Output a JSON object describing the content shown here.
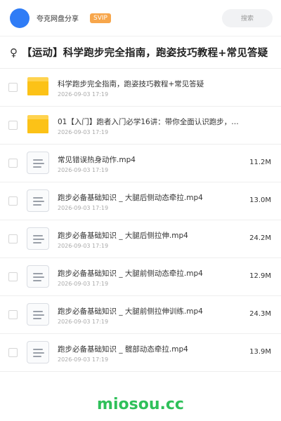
{
  "header": {
    "app_name": "夸克网盘分享",
    "badge": "SVIP",
    "search_placeholder": "搜索"
  },
  "share": {
    "gender_icon": "♀",
    "title": "【运动】科学跑步完全指南，跑姿技巧教程+常见答疑"
  },
  "files": [
    {
      "type": "folder",
      "name": "科学跑步完全指南，跑姿技巧教程+常见答疑",
      "date": "2026-09-03 17:19",
      "size": ""
    },
    {
      "type": "folder",
      "name": "01【入门】跑者入门必学16讲：带你全面认识跑步，…",
      "date": "2026-09-03 17:19",
      "size": ""
    },
    {
      "type": "file",
      "name": "常见错误热身动作.mp4",
      "date": "2026-09-03 17:19",
      "size": "11.2M"
    },
    {
      "type": "file",
      "name": "跑步必备基础知识 _ 大腿后侧动态牵拉.mp4",
      "date": "2026-09-03 17:19",
      "size": "13.0M"
    },
    {
      "type": "file",
      "name": "跑步必备基础知识 _ 大腿后侧拉伸.mp4",
      "date": "2026-09-03 17:19",
      "size": "24.2M"
    },
    {
      "type": "file",
      "name": "跑步必备基础知识 _ 大腿前侧动态牵拉.mp4",
      "date": "2026-09-03 17:19",
      "size": "12.9M"
    },
    {
      "type": "file",
      "name": "跑步必备基础知识 _ 大腿前侧拉伸训练.mp4",
      "date": "2026-09-03 17:19",
      "size": "24.3M"
    },
    {
      "type": "file",
      "name": "跑步必备基础知识 _ 髋部动态牵拉.mp4",
      "date": "2026-09-03 17:19",
      "size": "13.9M"
    }
  ],
  "watermark": "miosou.cc",
  "colors": {
    "avatar": "#2f7cf6",
    "badge": "#f7a64b",
    "folder": "#fcc217",
    "watermark": "#2fc05a"
  }
}
